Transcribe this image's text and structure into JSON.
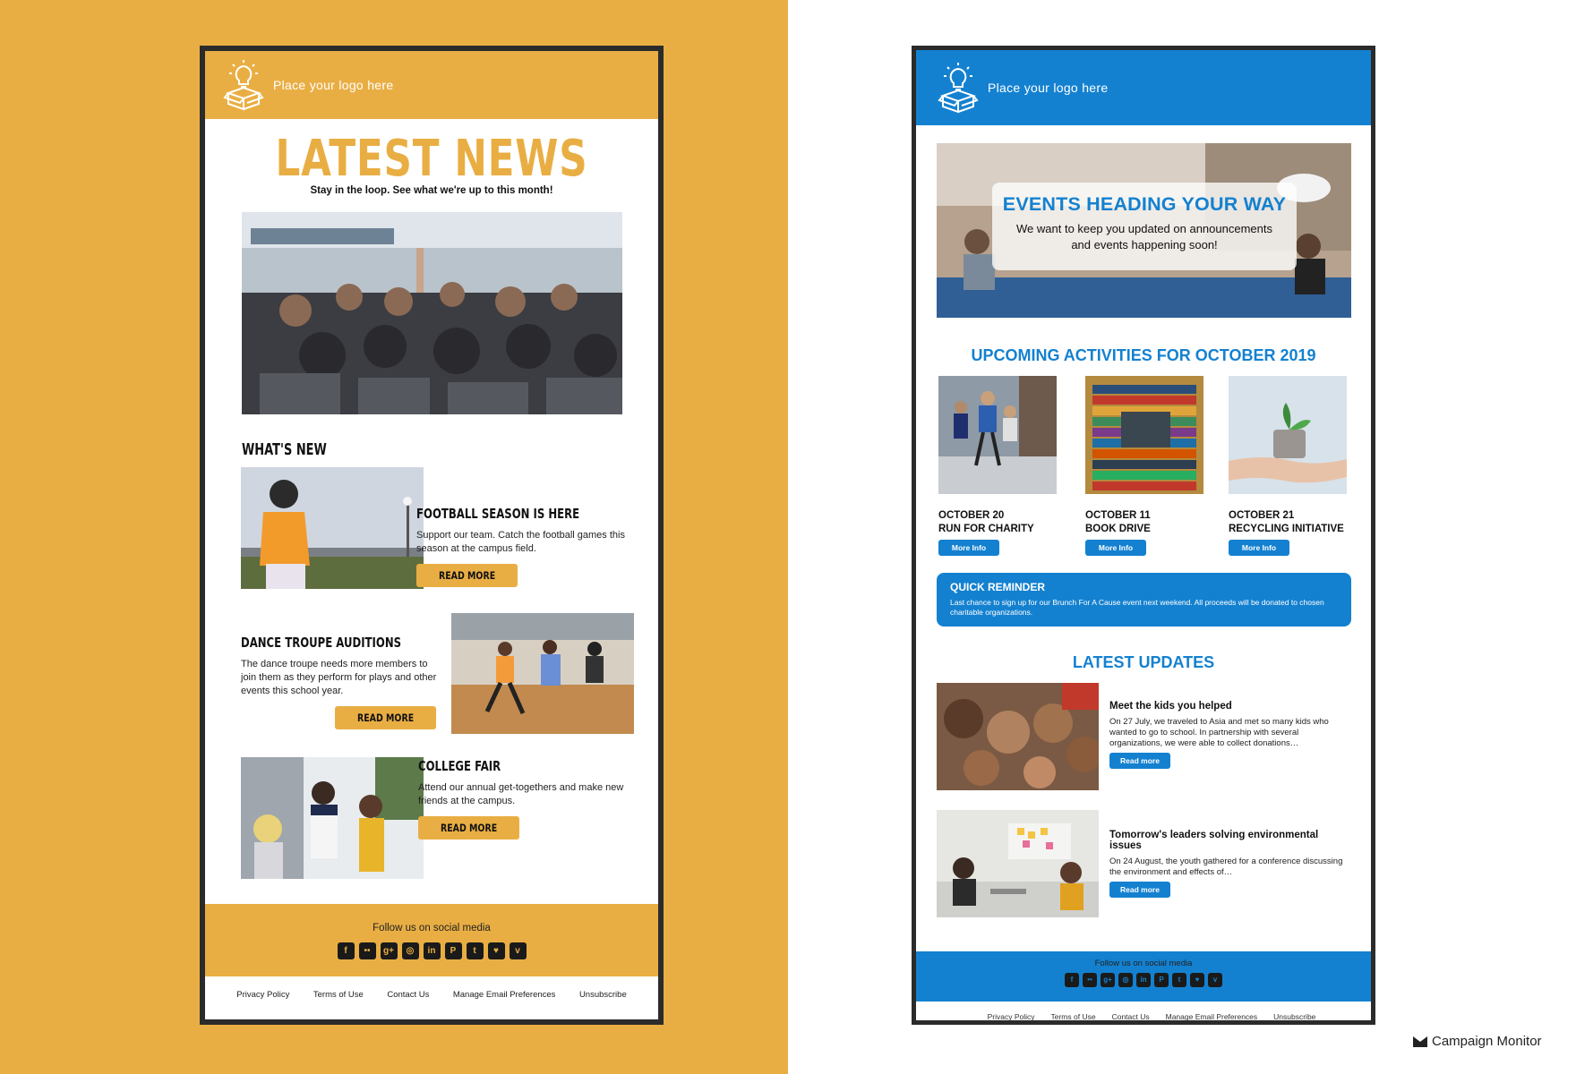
{
  "left": {
    "logo_text": "Place your logo here",
    "title": "LATEST NEWS",
    "subtitle": "Stay in the loop. See what we're up to this month!",
    "whats_new": "WHAT'S NEW",
    "articles": [
      {
        "title": "FOOTBALL SEASON IS HERE",
        "body": "Support our team. Catch the football games this season at the campus field.",
        "button": "READ MORE"
      },
      {
        "title": "DANCE TROUPE AUDITIONS",
        "body": "The dance troupe needs more members to join them as they perform for plays and other events this school year.",
        "button": "READ MORE"
      },
      {
        "title": "COLLEGE FAIR",
        "body": "Attend our annual get-togethers and make new friends at the campus.",
        "button": "READ MORE"
      }
    ],
    "footer_follow": "Follow us on social media",
    "links": [
      "Privacy Policy",
      "Terms of Use",
      "Contact Us",
      "Manage Email Preferences",
      "Unsubscribe"
    ],
    "accent": "#e9ae43"
  },
  "right": {
    "logo_text": "Place your logo here",
    "hero_title": "EVENTS HEADING YOUR WAY",
    "hero_sub_1": "We want to keep you updated on announcements",
    "hero_sub_2": "and events happening soon!",
    "activities_title": "UPCOMING ACTIVITIES FOR OCTOBER 2019",
    "activities": [
      {
        "date": "OCTOBER 20",
        "name": "RUN FOR CHARITY",
        "button": "More Info"
      },
      {
        "date": "OCTOBER 11",
        "name": "BOOK DRIVE",
        "button": "More Info"
      },
      {
        "date": "OCTOBER 21",
        "name": "RECYCLING INITIATIVE",
        "button": "More Info"
      }
    ],
    "reminder_title": "QUICK REMINDER",
    "reminder_body": "Last chance to sign up for our Brunch For A Cause event next weekend. All proceeds will be donated to chosen charitable organizations.",
    "updates_title": "LATEST UPDATES",
    "updates": [
      {
        "title": "Meet the kids you helped",
        "body": "On 27 July, we traveled to Asia and met so many kids who wanted to go to school. In partnership with several organizations, we were able to collect donations…",
        "button": "Read more"
      },
      {
        "title": "Tomorrow's leaders solving environmental issues",
        "body": "On 24 August, the youth gathered for a conference discussing the environment and effects of…",
        "button": "Read more"
      }
    ],
    "footer_follow": "Follow us on social media",
    "links": [
      "Privacy Policy",
      "Terms of Use",
      "Contact Us",
      "Manage Email Preferences",
      "Unsubscribe"
    ],
    "accent": "#1481d0"
  },
  "social_icons": [
    "f",
    "••",
    "g+",
    "◎",
    "in",
    "P",
    "t",
    "♥",
    "v"
  ],
  "brand": "Campaign Monitor"
}
